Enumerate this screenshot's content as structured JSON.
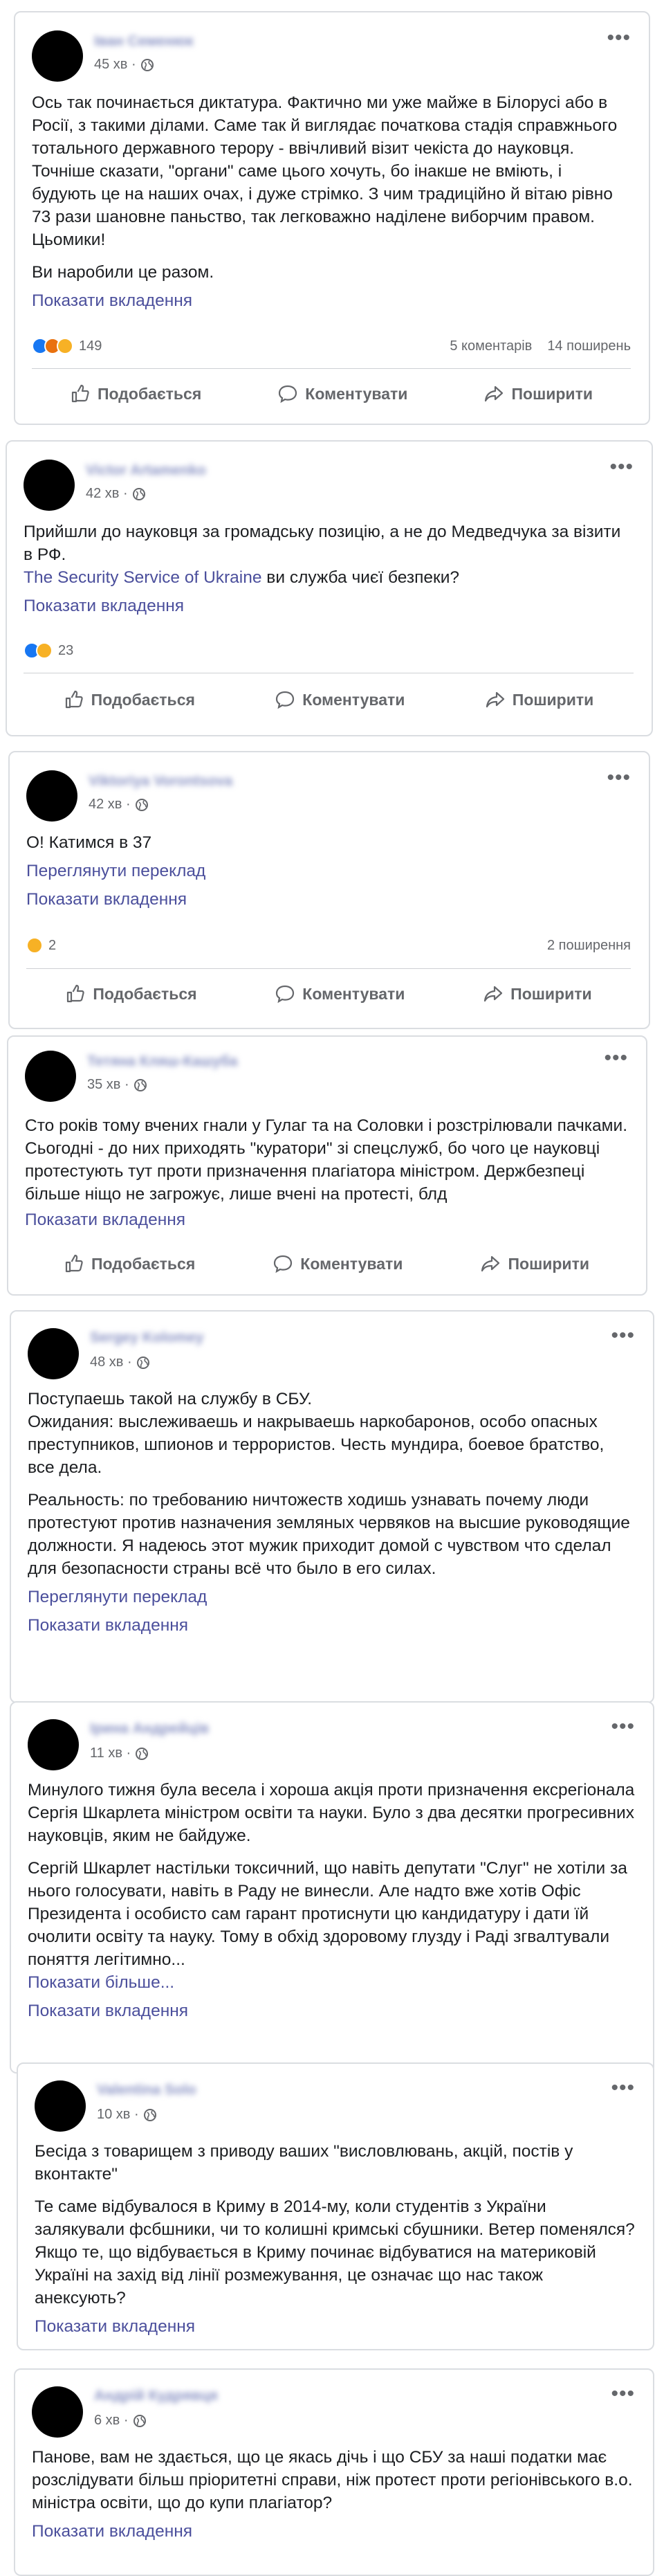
{
  "labels": {
    "show_attachments": "Показати вкладення",
    "see_translation": "Переглянути переклад",
    "show_more": "Показати більше...",
    "like": "Подобається",
    "comment": "Коментувати",
    "share": "Поширити"
  },
  "posts": [
    {
      "author": "Іван Семенюк",
      "time": "45 хв ·",
      "paragraphs": [
        "Ось так починається диктатура. Фактично ми уже майже в Білорусі або в Росії, з такими ділами. Саме так й виглядає початкова стадія справжнього тотального державного терору - ввічливий візит чекіста до науковця. Точніше сказати, \"органи\" саме цього хочуть, бо інакше не вміють, і будують це на наших очах, і дуже стрімко. З чим традиційно й вітаю рівно 73 рази шановне паньство, так легковажно наділене виборчим правом. Цьомики!",
        "Ви наробили це разом."
      ],
      "reaction_count": "149",
      "comments": "5 коментарів",
      "shares": "14 поширень"
    },
    {
      "author": "Victor Artamenko",
      "time": "42 хв ·",
      "paragraphs": [
        "Прийшли до науковця за громадську позицію, а не до Медведчука за візити в РФ."
      ],
      "mention": "The Security Service of Ukraine",
      "mention_rest": " ви служба чиєї безпеки?",
      "reaction_count": "23"
    },
    {
      "author": "Viktoriya Vorontsova",
      "time": "42 хв ·",
      "paragraphs": [
        "О! Катимся в 37"
      ],
      "reaction_count": "2",
      "shares": "2 поширення"
    },
    {
      "author": "Тетяна Кляш-Кашуба",
      "time": "35 хв ·",
      "paragraphs": [
        "Сто років тому вчених гнали у Гулаг та на Соловки і розстрілювали пачками. Сьогодні - до них приходять \"куратори\" зі спецслужб, бо чого це науковці протестують тут проти призначення плагіатора міністром. Держбезпеці більше ніщо не загрожує, лише вчені на протесті, блд"
      ]
    },
    {
      "author": "Sergey Kolomey",
      "time": "48 хв ·",
      "paragraphs": [
        "Поступаешь такой на службу в СБУ.\nОжидания: выслеживаешь и накрываешь наркобаронов, особо опасных преступников, шпионов и террористов. Честь мундира, боевое братство, все дела.",
        "Реальность: по требованию ничтожеств ходишь узнавать почему люди протестуют против назначения земляных червяков на высшие руководящие должности. Я надеюсь этот мужик приходит домой с чувством что сделал для безопасности страны всё что было в его силах."
      ]
    },
    {
      "author": "Ірина Андрейців",
      "time": "11 хв ·",
      "paragraphs": [
        "Минулого тижня була весела і хороша акція проти призначення екс­регіонала Сергія Шкарлета міністром освіти та науки. Було з два десятки прогресивних науковців, яким не байдуже.",
        "Сергій Шкарлет настільки токсичний, що навіть депутати \"Слуг\" не хотіли за нього голосувати, навіть в Раду не винесли. Але надто вже хотів Офіс Президента і особисто сам гарант протиснути цю кандидатуру і дати їй очолити освіту та науку. Тому в обхід здоровому глузду і Раді згвалтували поняття легітимно..."
      ]
    },
    {
      "author": "Valentina Solo",
      "time": "10 хв ·",
      "paragraphs": [
        "Бесіда з товарищем з приводу ваших \"висловлювань, акцій, постів у вконтакте\"",
        "Те саме відбувалося в Криму в 2014-му, коли студентів з України залякували фсбшники, чи то колишні кримські сбушники. Ветер поменялся? Якщо те, що відбувається в Криму починає відбуватися на материковій Україні на захід від лінії розмежування, це означає що нас також анексують?"
      ]
    },
    {
      "author": "Андрій Кудрявця",
      "time": "6 хв ·",
      "paragraphs": [
        "Панове, вам не здається, що це якась дічь і що СБУ за наші податки має розслідувати більш пріоритетні справи, ніж протест проти регіонівського в.о. міністра освіти, що до купи плагіатор?"
      ]
    }
  ],
  "colors": {
    "link": "#4b4f9c",
    "like_blue": "#1877f2",
    "angry": "#e9710f",
    "sad": "#f7b125",
    "muted": "#65676b"
  }
}
